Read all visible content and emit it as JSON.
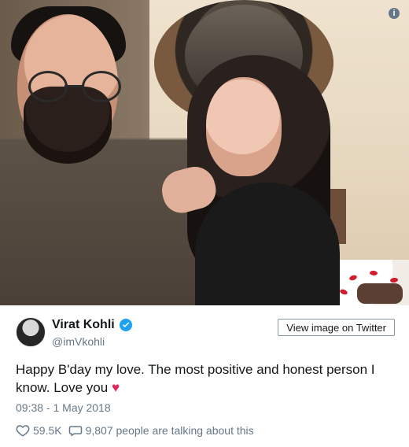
{
  "header": {
    "info_symbol": "i"
  },
  "tweet": {
    "author_name": "Virat Kohli",
    "author_handle": "@imVkohli",
    "view_button_label": "View image on Twitter",
    "text": "Happy B'day my love. The most positive and honest person I know. Love you",
    "emoji": "♥",
    "timestamp": "09:38 - 1 May 2018",
    "likes": "59.5K",
    "comments_text": "9,807 people are talking about this"
  },
  "colors": {
    "text_primary": "#14171a",
    "text_secondary": "#657786",
    "verified": "#1da1f2",
    "heart": "#e0245e"
  },
  "icons": {
    "info": "info-icon",
    "verified": "verified-badge-icon",
    "like": "heart-outline-icon",
    "comment": "speech-bubble-icon"
  }
}
